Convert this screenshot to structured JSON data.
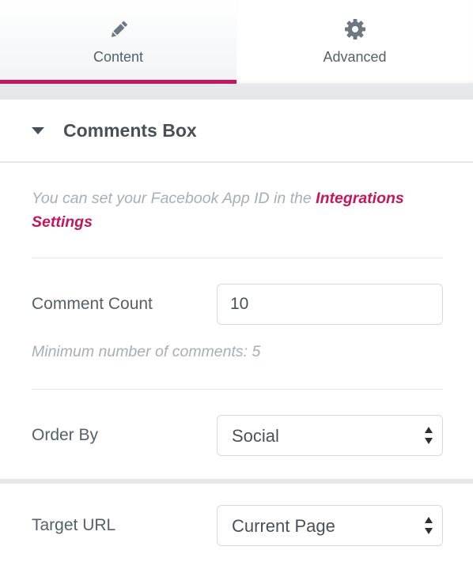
{
  "tabs": [
    {
      "label": "Content",
      "icon": "pencil-icon",
      "active": true
    },
    {
      "label": "Advanced",
      "icon": "gear-icon",
      "active": false
    }
  ],
  "colors": {
    "accent": "#c2185b",
    "text": "#495157",
    "muted": "#a4afb7",
    "border": "#d5dadf",
    "band": "#e6e9ec"
  },
  "section": {
    "title": "Comments Box",
    "expanded": true
  },
  "note": {
    "text": "You can set your Facebook App ID in the ",
    "link_label": "Integrations Settings"
  },
  "fields": {
    "comment_count": {
      "label": "Comment Count",
      "value": "10",
      "helper": "Minimum number of comments: 5"
    },
    "order_by": {
      "label": "Order By",
      "value": "Social"
    },
    "target_url": {
      "label": "Target URL",
      "value": "Current Page"
    }
  }
}
